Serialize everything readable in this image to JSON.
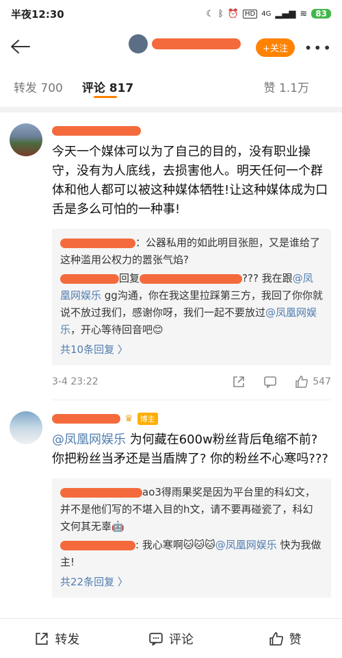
{
  "status": {
    "time": "半夜12:30",
    "signal": "4G",
    "battery": "83"
  },
  "nav": {
    "follow_label": "+关注",
    "more": "•••"
  },
  "tabs": {
    "repost": "转发 700",
    "comments": "评论 817",
    "likes": "赞 1.1万"
  },
  "comments": [
    {
      "text": "今天一个媒体可以为了自己的目的，没有职业操守，没有为人底线，去损害他人。明天任何一个群体和他人都可以被这种媒体牺牲!让这种媒体成为口舌是多么可怕的一种事!",
      "replies": [
        {
          "text": "：公器私用的如此明目张胆，又是谁给了这种滥用公权力的嚣张气焰?"
        },
        {
          "part1": "回复",
          "part2": "??? 我在跟",
          "mention1": "@凤凰网娱乐",
          "part3": " gg沟通，你在我这里拉踩第三方，我回了你你就说不放过我们，感谢你呀，我们一起不要放过",
          "mention2": "@凤凰网娱乐",
          "part4": "，开心等待回音吧😊"
        }
      ],
      "more_replies": "共10条回复 〉",
      "time": "3-4 23:22",
      "likes": "547"
    },
    {
      "badge": "博主",
      "mention": "@凤凰网娱乐",
      "text": " 为何藏在600w粉丝背后龟缩不前? 你把粉丝当矛还是当盾牌了? 你的粉丝不心寒吗???",
      "replies": [
        {
          "text": "ao3得雨果奖是因为平台里的科幻文，并不是他们写的不堪入目的h文，请不要再碰瓷了，科幻文何其无辜🤖"
        },
        {
          "part1": ": 我心寒啊🐱🐱🐱",
          "mention": "@凤凰网娱乐",
          "part2": " 快为我做主!"
        }
      ],
      "more_replies": "共22条回复 〉"
    }
  ],
  "bottom": {
    "repost": "转发",
    "comment": "评论",
    "like": "赞"
  }
}
